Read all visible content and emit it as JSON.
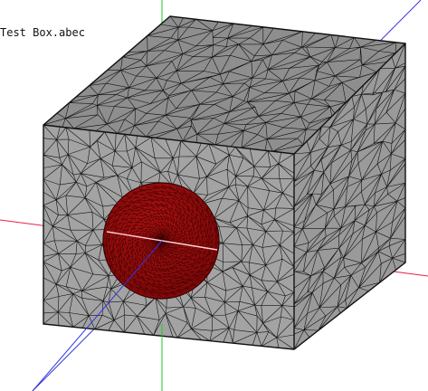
{
  "viewer": {
    "file_label": "Test Box.abec"
  },
  "scene": {
    "background_color": "#ffffff",
    "box_face_color": "#a3a3a3",
    "box_top_color": "#8e8e8e",
    "box_side_color": "#9a9a9a",
    "mesh_line_color": "#111111",
    "driver_color": "#b01010",
    "driver_mesh_color": "#3a0000",
    "axis_x_color": "#e8204a",
    "axis_y_color": "#1ec81e",
    "axis_z_color": "#3434e0"
  }
}
